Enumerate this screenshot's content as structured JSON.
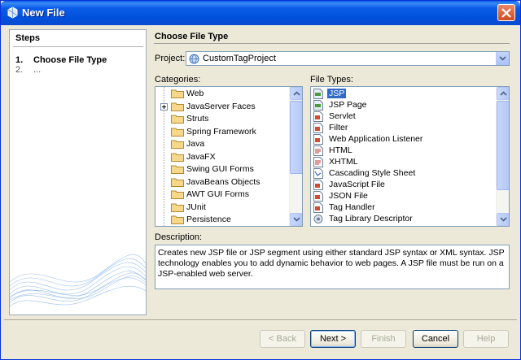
{
  "window": {
    "title": "New File"
  },
  "steps": {
    "title": "Steps",
    "items": [
      {
        "num": "1.",
        "label": "Choose File Type"
      },
      {
        "num": "2.",
        "label": "..."
      }
    ]
  },
  "main": {
    "section_title": "Choose File Type",
    "project_label": "Project:",
    "project_value": "CustomTagProject",
    "categories_label": "Categories:",
    "file_types_label": "File Types:",
    "categories": [
      {
        "label": "Web",
        "selected": true
      },
      {
        "label": "JavaServer Faces",
        "expandable": true
      },
      {
        "label": "Struts"
      },
      {
        "label": "Spring Framework"
      },
      {
        "label": "Java"
      },
      {
        "label": "JavaFX"
      },
      {
        "label": "Swing GUI Forms"
      },
      {
        "label": "JavaBeans Objects"
      },
      {
        "label": "AWT GUI Forms"
      },
      {
        "label": "JUnit"
      },
      {
        "label": "Persistence"
      }
    ],
    "file_types": [
      {
        "label": "JSP",
        "selected": true
      },
      {
        "label": "JSP Page"
      },
      {
        "label": "Servlet"
      },
      {
        "label": "Filter"
      },
      {
        "label": "Web Application Listener"
      },
      {
        "label": "HTML"
      },
      {
        "label": "XHTML"
      },
      {
        "label": "Cascading Style Sheet"
      },
      {
        "label": "JavaScript File"
      },
      {
        "label": "JSON File"
      },
      {
        "label": "Tag Handler"
      },
      {
        "label": "Tag Library Descriptor"
      }
    ],
    "description_label": "Description:",
    "description": "Creates new JSP file or JSP segment using either standard JSP syntax or XML syntax. JSP technology enables you to add dynamic behavior to web pages. A JSP file must be run on a JSP-enabled web server."
  },
  "buttons": {
    "back": "< Back",
    "next": "Next >",
    "finish": "Finish",
    "cancel": "Cancel",
    "help": "Help"
  },
  "colors": {
    "selection": "#316ac5",
    "titlebar": "#0a5de8",
    "dialog_bg": "#ece9d8"
  }
}
